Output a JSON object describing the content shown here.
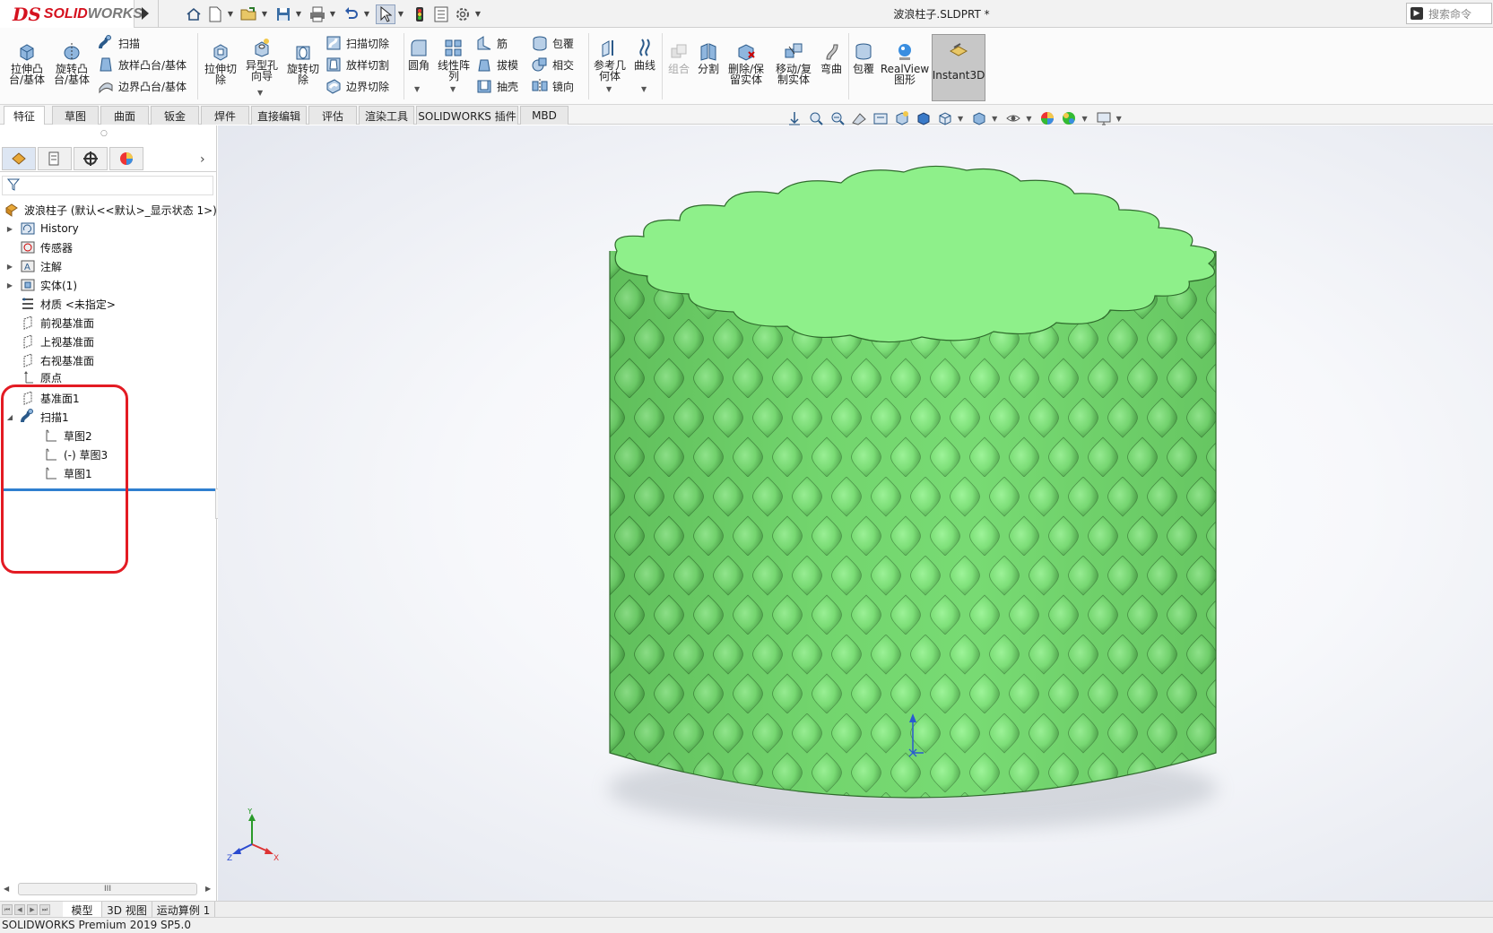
{
  "app": {
    "logo_ds": "DS",
    "logo_solid": "SOLID",
    "logo_works": "WORKS",
    "document_title": "波浪柱子.SLDPRT *",
    "search_placeholder": "搜索命令"
  },
  "quick_access": {
    "icons": [
      "home-icon",
      "new-document-icon",
      "open-icon",
      "save-icon",
      "print-icon",
      "undo-icon",
      "select-icon",
      "traffic-light-icon",
      "file-properties-icon",
      "options-icon"
    ]
  },
  "ribbon": {
    "extrude_boss": "拉伸凸\n台/基体",
    "revolve_boss": "旋转凸\n台/基体",
    "sweep": "扫描",
    "loft_boss": "放样凸台/基体",
    "boundary_boss": "边界凸台/基体",
    "extrude_cut": "拉伸切\n除",
    "hole_wizard": "异型孔\n向导",
    "revolve_cut": "旋转切\n除",
    "swept_cut": "扫描切除",
    "lofted_cut": "放样切割",
    "boundary_cut": "边界切除",
    "fillet": "圆角",
    "linear_pattern": "线性阵\n列",
    "rib": "筋",
    "draft": "拔模",
    "shell": "抽壳",
    "wrap": "包覆",
    "intersect": "相交",
    "mirror": "镜向",
    "reference_geometry": "参考几\n何体",
    "curves": "曲线",
    "combine": "组合",
    "split": "分割",
    "delete_keep_body": "删除/保\n留实体",
    "move_copy_body": "移动/复\n制实体",
    "flex": "弯曲",
    "wrap2": "包覆",
    "realview": "RealView\n图形",
    "instant3d": "Instant3D"
  },
  "command_tabs": [
    "特征",
    "草图",
    "曲面",
    "钣金",
    "焊件",
    "直接编辑",
    "评估",
    "渲染工具",
    "SOLIDWORKS 插件",
    "MBD"
  ],
  "active_command_tab": "特征",
  "feature_tree": {
    "root": "波浪柱子 (默认<<默认>_显示状态 1>)",
    "items": [
      {
        "label": "History",
        "icon": "history-icon",
        "expandable": true
      },
      {
        "label": "传感器",
        "icon": "sensor-icon",
        "expandable": false
      },
      {
        "label": "注解",
        "icon": "annotation-icon",
        "expandable": true
      },
      {
        "label": "实体(1)",
        "icon": "solid-bodies-icon",
        "expandable": true
      },
      {
        "label": "材质 <未指定>",
        "icon": "material-icon",
        "expandable": false
      },
      {
        "label": "前视基准面",
        "icon": "plane-icon",
        "expandable": false
      },
      {
        "label": "上视基准面",
        "icon": "plane-icon",
        "expandable": false
      },
      {
        "label": "右视基准面",
        "icon": "plane-icon",
        "expandable": false
      },
      {
        "label": "原点",
        "icon": "origin-icon",
        "expandable": false
      },
      {
        "label": "基准面1",
        "icon": "plane-icon",
        "expandable": false
      },
      {
        "label": "扫描1",
        "icon": "sweep-icon",
        "expandable": true,
        "expanded": true
      },
      {
        "label": "草图2",
        "icon": "sketch-icon",
        "child": true
      },
      {
        "label": "(-) 草图3",
        "icon": "sketch-icon",
        "child": true
      },
      {
        "label": "草图1",
        "icon": "sketch-icon",
        "child": true
      }
    ]
  },
  "bottom_tabs": [
    "模型",
    "3D 视图",
    "运动算例 1"
  ],
  "active_bottom_tab": "模型",
  "status_bar": "SOLIDWORKS Premium 2019 SP5.0",
  "hscroll_label": "III",
  "triad": {
    "y": "Y",
    "z": "Z",
    "x": "X"
  },
  "colors": {
    "model_green": "#8ef08a",
    "brand_red": "#d5121f",
    "highlight_red": "#e31b23",
    "rollback_blue": "#2f7fd0"
  }
}
